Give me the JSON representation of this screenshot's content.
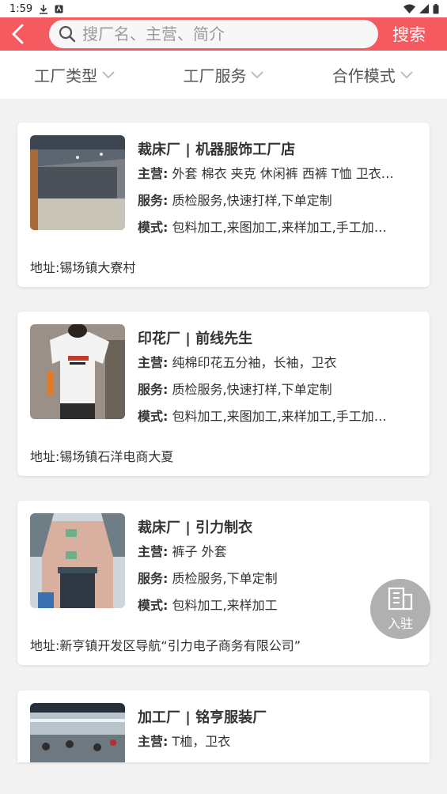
{
  "status_bar": {
    "time": "1:59"
  },
  "search": {
    "placeholder": "搜厂名、主营、简介",
    "button_label": "搜索"
  },
  "filters": [
    {
      "label": "工厂类型"
    },
    {
      "label": "工厂服务"
    },
    {
      "label": "合作模式"
    }
  ],
  "labels": {
    "main": "主营:",
    "service": "服务:",
    "mode": "模式:",
    "address": "地址:"
  },
  "factories": [
    {
      "title": "裁床厂 | 机器服饰工厂店",
      "main": "外套 棉衣 夹克 休闲裤 西裤 T恤 卫衣…",
      "service": "质检服务,快速打样,下单定制",
      "mode": "包料加工,来图加工,来样加工,手工加…",
      "address": "锡场镇大寮村",
      "thumb": "warehouse"
    },
    {
      "title": "印花厂 | 前线先生",
      "main": "纯棉印花五分袖，长袖，卫衣",
      "service": "质检服务,快速打样,下单定制",
      "mode": "包料加工,来图加工,来样加工,手工加…",
      "address": "锡场镇石洋电商大夏",
      "thumb": "tshirt"
    },
    {
      "title": "裁床厂 | 引力制衣",
      "main": "裤子 外套",
      "service": "质检服务,下单定制",
      "mode": "包料加工,来样加工",
      "address": "新亨镇开发区导航“引力电子商务有限公司”",
      "thumb": "building"
    },
    {
      "title": "加工厂 | 铭亨服装厂",
      "main": "T桖，卫衣",
      "service": "",
      "mode": "",
      "address": "",
      "thumb": "workshop"
    }
  ],
  "fab": {
    "label": "入驻"
  },
  "colors": {
    "accent": "#f45a5f",
    "background": "#f2f2f2"
  }
}
